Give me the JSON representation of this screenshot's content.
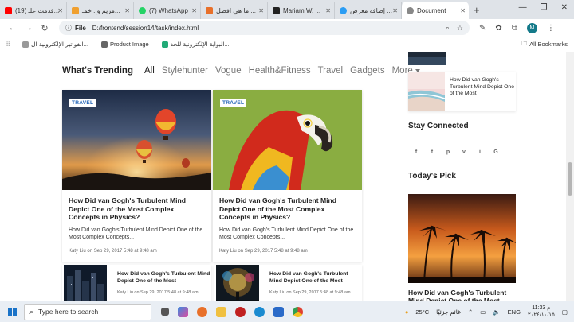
{
  "browser": {
    "tabs": [
      {
        "title": "(19) قدمت علـ...",
        "color": "#ff0000"
      },
      {
        "title": "مريم و . خمـ...",
        "color": "#f0a030"
      },
      {
        "title": "(7) WhatsApp",
        "color": "#25d366"
      },
      {
        "title": "ما هي افضل ...",
        "color": "#e8702a"
      },
      {
        "title": "Mariam W. ...",
        "color": "#222222"
      },
      {
        "title": "إضافة معرض ...",
        "color": "#2a9df4"
      },
      {
        "title": "Document",
        "color": "#888888",
        "active": true
      }
    ],
    "address": {
      "label": "File",
      "url": "D:/frontend/session14/task/index.html"
    },
    "avatar_letter": "M",
    "bookmarks": [
      {
        "label": "الفواتير الإلكترونية ال..."
      },
      {
        "label": "Product Image"
      },
      {
        "label": "البوابة الإلكترونية للخد..."
      }
    ],
    "all_bookmarks": "All Bookmarks"
  },
  "trending": {
    "heading": "What's Trending",
    "categories": [
      "All",
      "Stylehunter",
      "Vogue",
      "Health&Fitness",
      "Travel",
      "Gadgets",
      "More"
    ]
  },
  "cards": [
    {
      "badge": "TRAVEL",
      "title": "How Did van Gogh's Turbulent Mind Depict One of the Most Complex Concepts in Physics?",
      "excerpt": "How Did van Gogh's Turbulent Mind Depict One of the Most Complex Concepts...",
      "meta": "Katy Liu on Sep 29, 2017 5:48 at 9:48 am"
    },
    {
      "badge": "TRAVEL",
      "title": "How Did van Gogh's Turbulent Mind Depict One of the Most Complex Concepts in Physics?",
      "excerpt": "How Did van Gogh's Turbulent Mind Depict One of the Most Complex Concepts...",
      "meta": "Katy Liu on Sep 29, 2017 5:48 at 9:48 am"
    }
  ],
  "small_cards": [
    {
      "title": "How Did van Gogh's Turbulent Mind Depict One of the Most",
      "meta": "Katy Liu on Sep 29, 2017 5:48 at 9:48 am"
    },
    {
      "title": "How Did van Gogh's Turbulent Mind Depict One of the Most",
      "meta": "Katy Liu on Sep 29, 2017 5:48 at 9:48 am"
    }
  ],
  "sidebar": {
    "mini_post_title": "How Did van Gogh's Turbulent Mind Depict One of the Most",
    "stay_connected": "Stay Connected",
    "socials": [
      "f",
      "t",
      "p",
      "v",
      "i",
      "G"
    ],
    "todays_pick": "Today's Pick",
    "pick_title": "How Did van Gogh's Turbulent Mind Depict One of the Most"
  },
  "taskbar": {
    "search_placeholder": "Type here to search",
    "weather": "25°C",
    "weather_text": "غائم جزئيًا",
    "lang": "ENG",
    "time": "11:33 م",
    "date": "٢٠٢٤/١٠/١٥"
  }
}
